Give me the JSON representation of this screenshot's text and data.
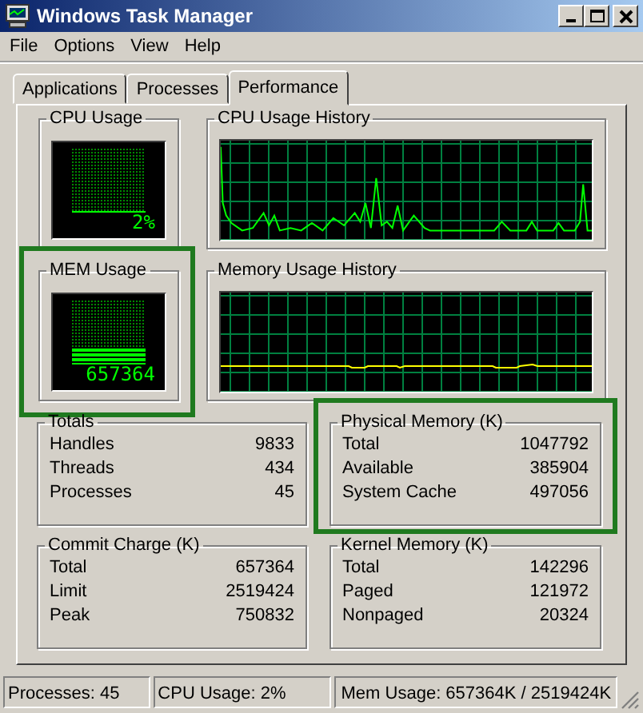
{
  "window": {
    "title": "Windows Task Manager"
  },
  "menu": [
    "File",
    "Options",
    "View",
    "Help"
  ],
  "tabs": [
    {
      "label": "Applications",
      "selected": false
    },
    {
      "label": "Processes",
      "selected": false
    },
    {
      "label": "Performance",
      "selected": true
    }
  ],
  "meters": [
    {
      "title": "CPU Usage",
      "reading": "2%",
      "highlighted": false
    },
    {
      "title": "MEM Usage",
      "reading": "657364",
      "highlighted": true
    }
  ],
  "histories": [
    {
      "title": "CPU Usage History",
      "kind": "cpu"
    },
    {
      "title": "Memory Usage History",
      "kind": "memory"
    }
  ],
  "groups": [
    {
      "title": "Totals",
      "highlighted": false,
      "rows": [
        {
          "label": "Handles",
          "value": "9833"
        },
        {
          "label": "Threads",
          "value": "434"
        },
        {
          "label": "Processes",
          "value": "45"
        }
      ]
    },
    {
      "title": "Physical Memory (K)",
      "highlighted": true,
      "rows": [
        {
          "label": "Total",
          "value": "1047792"
        },
        {
          "label": "Available",
          "value": "385904"
        },
        {
          "label": "System Cache",
          "value": "497056"
        }
      ]
    },
    {
      "title": "Commit Charge (K)",
      "highlighted": false,
      "rows": [
        {
          "label": "Total",
          "value": "657364"
        },
        {
          "label": "Limit",
          "value": "2519424"
        },
        {
          "label": "Peak",
          "value": "750832"
        }
      ]
    },
    {
      "title": "Kernel Memory (K)",
      "highlighted": false,
      "rows": [
        {
          "label": "Total",
          "value": "142296"
        },
        {
          "label": "Paged",
          "value": "121972"
        },
        {
          "label": "Nonpaged",
          "value": "20324"
        }
      ]
    }
  ],
  "status_bar": [
    "Processes: 45",
    "CPU Usage: 2%",
    "Mem Usage: 657364K / 2519424K"
  ]
}
